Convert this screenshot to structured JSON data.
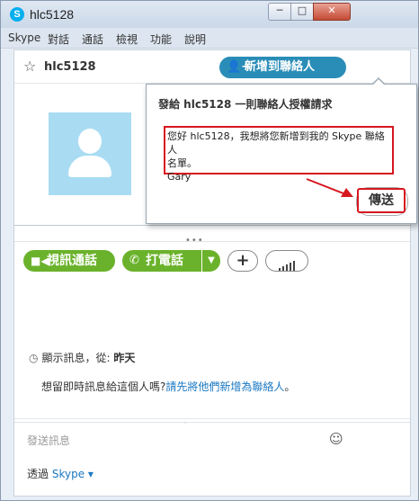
{
  "window": {
    "title": "hlc5128",
    "minimize_label": "─",
    "maximize_label": "□",
    "close_label": "✕"
  },
  "menu": [
    "Skype",
    "對話",
    "通話",
    "檢視",
    "功能",
    "說明"
  ],
  "header": {
    "contact_name": "hlc5128",
    "add_contact_label": "新增到聯絡人"
  },
  "calls": {
    "video_label": "視訊通話",
    "phone_label": "打電話",
    "add_label": "+"
  },
  "history": {
    "label": "顯示訊息，從:",
    "value": "昨天"
  },
  "notice": {
    "text": "想留即時訊息給這個人嗎?",
    "link": "請先將他們新增為聯絡人",
    "tail": "。"
  },
  "compose": {
    "placeholder": "發送訊息"
  },
  "via": {
    "label": "透過",
    "service": "Skype"
  },
  "popup": {
    "title": "發給 hlc5128 一則聯絡人授權請求",
    "message_line1": "您好 hlc5128，我想將您新增到我的 Skype 聯絡人",
    "message_line2": "名單。",
    "message_line3": "Gary",
    "send_label": "傳送"
  },
  "colors": {
    "accent_blue": "#2a8db7",
    "call_green": "#6ab22b",
    "highlight_red": "#d6171f",
    "avatar_bg": "#a9dcf3"
  }
}
